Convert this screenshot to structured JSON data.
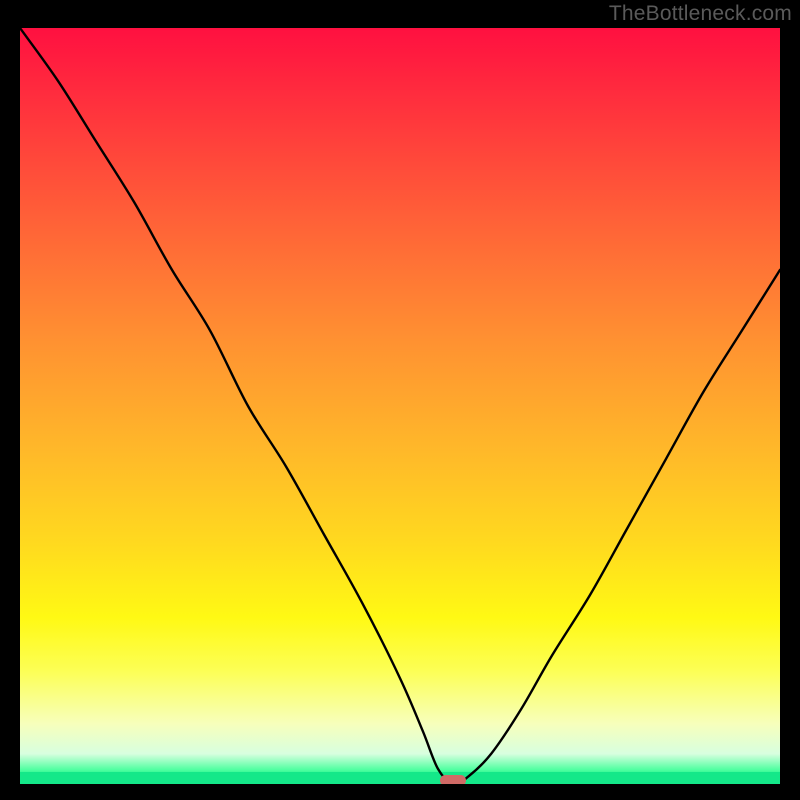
{
  "watermark": "TheBottleneck.com",
  "chart_data": {
    "type": "line",
    "title": "",
    "xlabel": "",
    "ylabel": "",
    "xlim": [
      0,
      100
    ],
    "ylim": [
      0,
      100
    ],
    "grid": false,
    "legend": false,
    "marker": {
      "x": 57,
      "y": 0
    },
    "x": [
      0,
      5,
      10,
      15,
      20,
      25,
      30,
      35,
      40,
      45,
      50,
      53,
      55,
      57,
      59,
      62,
      66,
      70,
      75,
      80,
      85,
      90,
      95,
      100
    ],
    "values": [
      100,
      93,
      85,
      77,
      68,
      60,
      50,
      42,
      33,
      24,
      14,
      7,
      2,
      0,
      1,
      4,
      10,
      17,
      25,
      34,
      43,
      52,
      60,
      68
    ],
    "colors": {
      "gradient_top": "#ff1040",
      "gradient_bottom": "#14e889",
      "curve": "#000000",
      "marker": "#d06a66",
      "background": "#000000"
    }
  }
}
